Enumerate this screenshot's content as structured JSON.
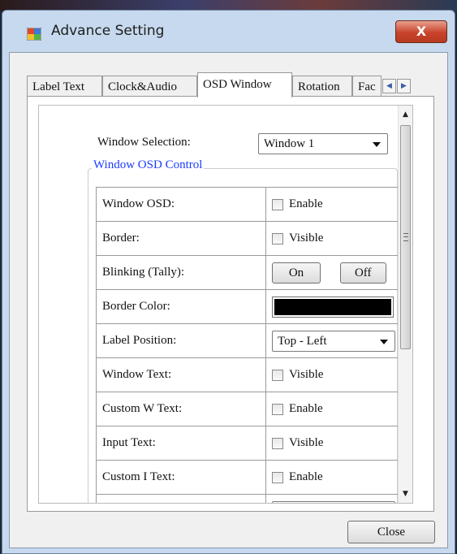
{
  "window": {
    "title": "Advance Setting",
    "close_glyph": "X",
    "icon": "app-window-icon"
  },
  "tabs": [
    {
      "label": "Label Text",
      "active": false
    },
    {
      "label": "Clock&Audio",
      "active": false
    },
    {
      "label": "OSD Window",
      "active": true
    },
    {
      "label": "Rotation",
      "active": false
    },
    {
      "label": "Fac",
      "active": false
    }
  ],
  "tab_scroll": {
    "left": "◀",
    "right": "▶"
  },
  "osd": {
    "window_selection_label": "Window Selection:",
    "window_selection_value": "Window 1",
    "group_title": "Window OSD Control",
    "rows": [
      {
        "label": "Window OSD:",
        "control": "checkbox",
        "text": "Enable",
        "checked": false
      },
      {
        "label": "Border:",
        "control": "checkbox",
        "text": "Visible",
        "checked": false
      },
      {
        "label": "Blinking (Tally):",
        "control": "buttons",
        "on": "On",
        "off": "Off"
      },
      {
        "label": "Border Color:",
        "control": "color",
        "color": "#000000"
      },
      {
        "label": "Label Position:",
        "control": "combo",
        "value": "Top - Left"
      },
      {
        "label": "Window Text:",
        "control": "checkbox",
        "text": "Visible",
        "checked": false
      },
      {
        "label": "Custom W Text:",
        "control": "checkbox",
        "text": "Enable",
        "checked": false
      },
      {
        "label": "Input Text:",
        "control": "checkbox",
        "text": "Visible",
        "checked": false
      },
      {
        "label": "Custom I Text:",
        "control": "checkbox",
        "text": "Enable",
        "checked": false
      }
    ]
  },
  "scrollbar": {
    "up": "▲",
    "down": "▼"
  },
  "footer": {
    "close_label": "Close"
  }
}
